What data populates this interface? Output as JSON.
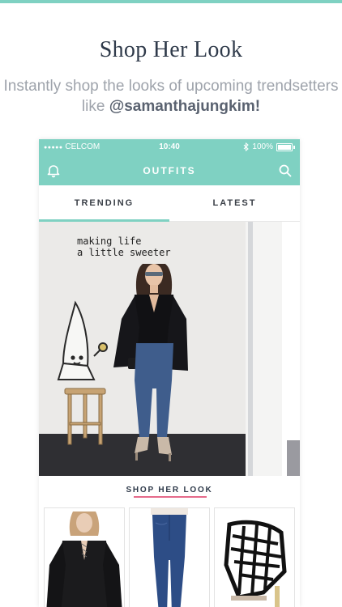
{
  "marketing": {
    "headline": "Shop Her Look",
    "subline_prefix": "Instantly shop the looks of upcoming trendsetters like ",
    "subline_handle": "@samanthajungkim!"
  },
  "status": {
    "carrier": "CELCOM",
    "signal_dots": "●●●●●",
    "time": "10:40",
    "battery": "100%"
  },
  "navbar": {
    "title": "OUTFITS"
  },
  "tabs": [
    {
      "label": "TRENDING",
      "active": true
    },
    {
      "label": "LATEST",
      "active": false
    }
  ],
  "post": {
    "wall_text_line1": "making life",
    "wall_text_line2": "a little sweeter",
    "shop_label": "SHOP HER LOOK"
  },
  "products": [
    {
      "name_icon": "black-lace-up-top"
    },
    {
      "name_icon": "skinny-jeans"
    },
    {
      "name_icon": "black-caged-heels"
    }
  ],
  "colors": {
    "accent": "#7fd1c2",
    "headline": "#2f3a4a",
    "subline": "#9ea3ab",
    "shop_rule": "#e56a8a"
  }
}
